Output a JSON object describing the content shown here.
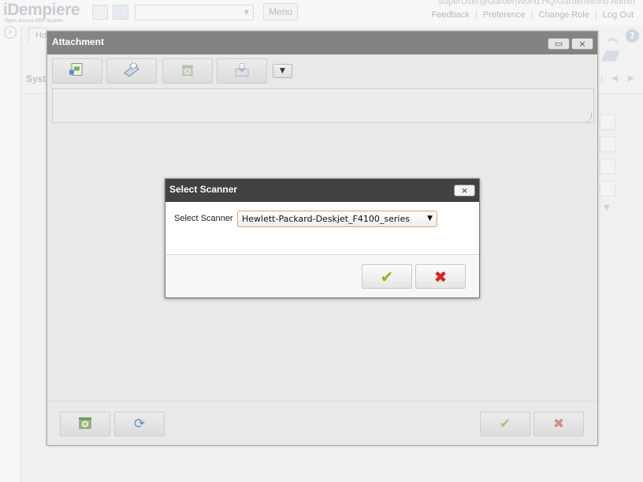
{
  "app": {
    "logo": "iDempiere",
    "logo_tagline": "Open Source ERP System",
    "menu_label": "Menu",
    "user_info": "SuperUser@GardenWorld.HQ/GardenWorld Admin",
    "header_links": [
      "Feedback",
      "Preference",
      "Change Role",
      "Log Out"
    ],
    "home_tab": "Ho",
    "bg_title": "Syst"
  },
  "attachment_window": {
    "title": "Attachment",
    "toolbar_icons": [
      "load-file-icon",
      "scan-icon",
      "delete-icon",
      "save-icon"
    ],
    "dropdown_glyph": "▼",
    "text_value": "",
    "footer_left_icons": [
      "delete-all-icon",
      "refresh-icon"
    ],
    "footer_right_icons": [
      "ok-icon",
      "cancel-icon"
    ]
  },
  "scanner_dialog": {
    "title": "Select Scanner",
    "label": "Select Scanner",
    "selected_scanner": "Hewlett-Packard-Deskjet_F4100_series",
    "close_glyph": "×",
    "ok_glyph": "✔",
    "cancel_glyph": "✖"
  },
  "colors": {
    "dialog_header": "#424242",
    "window_header": "#838383",
    "ok_green": "#8cb51c",
    "cancel_red": "#d8201d",
    "select_border": "#e0a35a"
  }
}
